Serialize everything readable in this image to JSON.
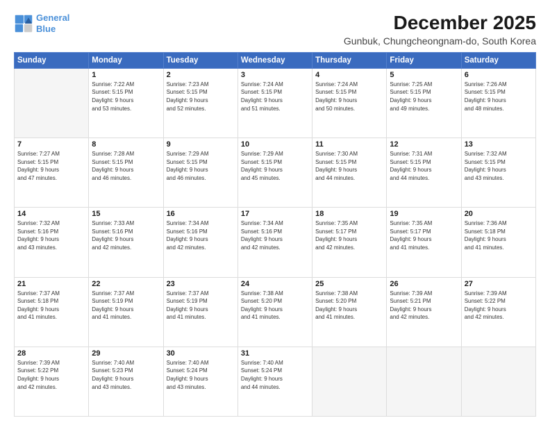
{
  "logo": {
    "line1": "General",
    "line2": "Blue"
  },
  "title": "December 2025",
  "subtitle": "Gunbuk, Chungcheongnam-do, South Korea",
  "weekdays": [
    "Sunday",
    "Monday",
    "Tuesday",
    "Wednesday",
    "Thursday",
    "Friday",
    "Saturday"
  ],
  "weeks": [
    [
      {
        "day": "",
        "info": ""
      },
      {
        "day": "1",
        "info": "Sunrise: 7:22 AM\nSunset: 5:15 PM\nDaylight: 9 hours\nand 53 minutes."
      },
      {
        "day": "2",
        "info": "Sunrise: 7:23 AM\nSunset: 5:15 PM\nDaylight: 9 hours\nand 52 minutes."
      },
      {
        "day": "3",
        "info": "Sunrise: 7:24 AM\nSunset: 5:15 PM\nDaylight: 9 hours\nand 51 minutes."
      },
      {
        "day": "4",
        "info": "Sunrise: 7:24 AM\nSunset: 5:15 PM\nDaylight: 9 hours\nand 50 minutes."
      },
      {
        "day": "5",
        "info": "Sunrise: 7:25 AM\nSunset: 5:15 PM\nDaylight: 9 hours\nand 49 minutes."
      },
      {
        "day": "6",
        "info": "Sunrise: 7:26 AM\nSunset: 5:15 PM\nDaylight: 9 hours\nand 48 minutes."
      }
    ],
    [
      {
        "day": "7",
        "info": "Sunrise: 7:27 AM\nSunset: 5:15 PM\nDaylight: 9 hours\nand 47 minutes."
      },
      {
        "day": "8",
        "info": "Sunrise: 7:28 AM\nSunset: 5:15 PM\nDaylight: 9 hours\nand 46 minutes."
      },
      {
        "day": "9",
        "info": "Sunrise: 7:29 AM\nSunset: 5:15 PM\nDaylight: 9 hours\nand 46 minutes."
      },
      {
        "day": "10",
        "info": "Sunrise: 7:29 AM\nSunset: 5:15 PM\nDaylight: 9 hours\nand 45 minutes."
      },
      {
        "day": "11",
        "info": "Sunrise: 7:30 AM\nSunset: 5:15 PM\nDaylight: 9 hours\nand 44 minutes."
      },
      {
        "day": "12",
        "info": "Sunrise: 7:31 AM\nSunset: 5:15 PM\nDaylight: 9 hours\nand 44 minutes."
      },
      {
        "day": "13",
        "info": "Sunrise: 7:32 AM\nSunset: 5:15 PM\nDaylight: 9 hours\nand 43 minutes."
      }
    ],
    [
      {
        "day": "14",
        "info": "Sunrise: 7:32 AM\nSunset: 5:16 PM\nDaylight: 9 hours\nand 43 minutes."
      },
      {
        "day": "15",
        "info": "Sunrise: 7:33 AM\nSunset: 5:16 PM\nDaylight: 9 hours\nand 42 minutes."
      },
      {
        "day": "16",
        "info": "Sunrise: 7:34 AM\nSunset: 5:16 PM\nDaylight: 9 hours\nand 42 minutes."
      },
      {
        "day": "17",
        "info": "Sunrise: 7:34 AM\nSunset: 5:16 PM\nDaylight: 9 hours\nand 42 minutes."
      },
      {
        "day": "18",
        "info": "Sunrise: 7:35 AM\nSunset: 5:17 PM\nDaylight: 9 hours\nand 42 minutes."
      },
      {
        "day": "19",
        "info": "Sunrise: 7:35 AM\nSunset: 5:17 PM\nDaylight: 9 hours\nand 41 minutes."
      },
      {
        "day": "20",
        "info": "Sunrise: 7:36 AM\nSunset: 5:18 PM\nDaylight: 9 hours\nand 41 minutes."
      }
    ],
    [
      {
        "day": "21",
        "info": "Sunrise: 7:37 AM\nSunset: 5:18 PM\nDaylight: 9 hours\nand 41 minutes."
      },
      {
        "day": "22",
        "info": "Sunrise: 7:37 AM\nSunset: 5:19 PM\nDaylight: 9 hours\nand 41 minutes."
      },
      {
        "day": "23",
        "info": "Sunrise: 7:37 AM\nSunset: 5:19 PM\nDaylight: 9 hours\nand 41 minutes."
      },
      {
        "day": "24",
        "info": "Sunrise: 7:38 AM\nSunset: 5:20 PM\nDaylight: 9 hours\nand 41 minutes."
      },
      {
        "day": "25",
        "info": "Sunrise: 7:38 AM\nSunset: 5:20 PM\nDaylight: 9 hours\nand 41 minutes."
      },
      {
        "day": "26",
        "info": "Sunrise: 7:39 AM\nSunset: 5:21 PM\nDaylight: 9 hours\nand 42 minutes."
      },
      {
        "day": "27",
        "info": "Sunrise: 7:39 AM\nSunset: 5:22 PM\nDaylight: 9 hours\nand 42 minutes."
      }
    ],
    [
      {
        "day": "28",
        "info": "Sunrise: 7:39 AM\nSunset: 5:22 PM\nDaylight: 9 hours\nand 42 minutes."
      },
      {
        "day": "29",
        "info": "Sunrise: 7:40 AM\nSunset: 5:23 PM\nDaylight: 9 hours\nand 43 minutes."
      },
      {
        "day": "30",
        "info": "Sunrise: 7:40 AM\nSunset: 5:24 PM\nDaylight: 9 hours\nand 43 minutes."
      },
      {
        "day": "31",
        "info": "Sunrise: 7:40 AM\nSunset: 5:24 PM\nDaylight: 9 hours\nand 44 minutes."
      },
      {
        "day": "",
        "info": ""
      },
      {
        "day": "",
        "info": ""
      },
      {
        "day": "",
        "info": ""
      }
    ]
  ]
}
